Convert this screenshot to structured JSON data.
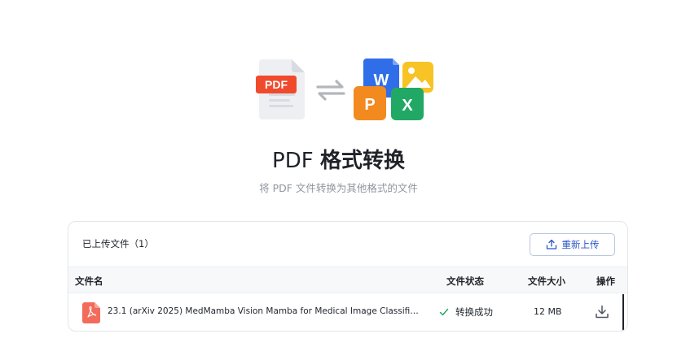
{
  "hero": {
    "pdf_badge": "PDF",
    "word_letter": "W",
    "ppt_letter": "P",
    "excel_letter": "X"
  },
  "header": {
    "title_prefix": "PDF",
    "title_main": "格式转换",
    "subtitle": "将 PDF 文件转换为其他格式的文件"
  },
  "upload": {
    "uploaded_label": "已上传文件（1）",
    "reupload_label": "重新上传"
  },
  "table": {
    "columns": {
      "name": "文件名",
      "status": "文件状态",
      "size": "文件大小",
      "action": "操作"
    },
    "rows": [
      {
        "name": "23.1 (arXiv 2025) MedMamba Vision Mamba for Medical Image Classification.pdf",
        "status": "转换成功",
        "size": "12 MB"
      }
    ]
  },
  "colors": {
    "pdf_red": "#f04a2d",
    "word_blue": "#2f6ee8",
    "ppt_orange": "#f28a1f",
    "excel_green": "#21a865",
    "image_yellow": "#f7c325",
    "success_green": "#20a162",
    "link_blue": "#2a56c6"
  }
}
